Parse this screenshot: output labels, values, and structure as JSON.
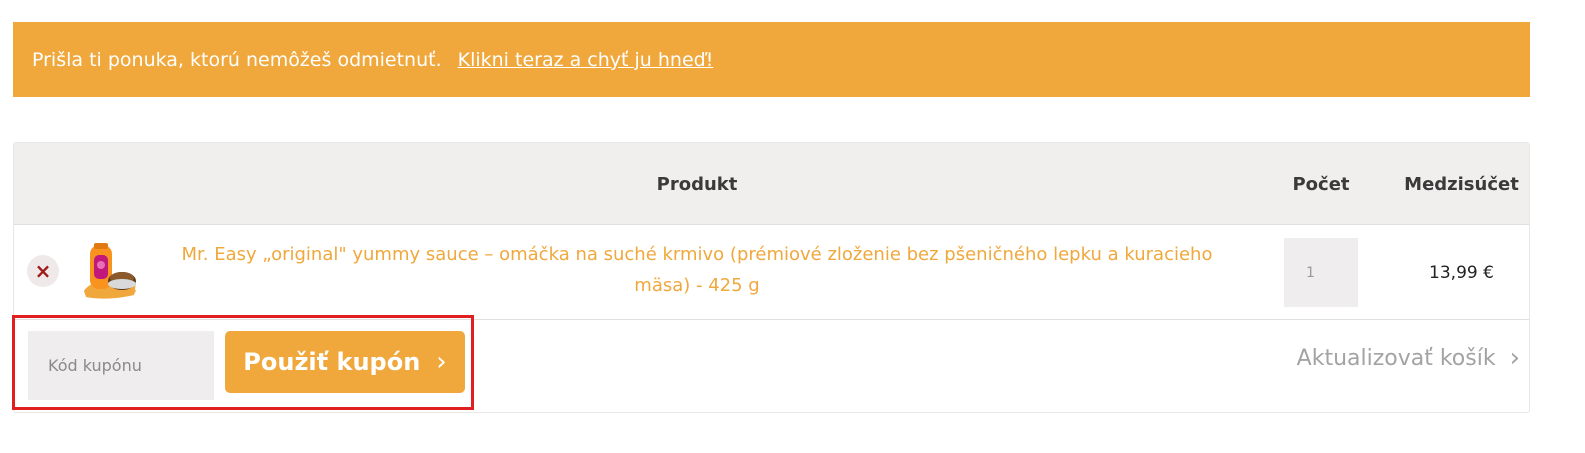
{
  "notice": {
    "message": "Prišla ti ponuka, ktorú nemôžeš odmietnuť.",
    "link": "Klikni teraz a chyť ju hneď!"
  },
  "cart": {
    "headers": {
      "product": "Produkt",
      "quantity": "Počet",
      "subtotal": "Medzisúčet"
    },
    "item": {
      "name": "Mr. Easy „original\" yummy sauce – omáčka na suché krmivo (prémiové zloženie bez pšeničného lepku a kuracieho mäsa) - 425 g",
      "quantity": "1",
      "price": "13,99 €",
      "remove_icon": "×"
    },
    "coupon": {
      "placeholder": "Kód kupónu",
      "apply_label": "Použiť kupón",
      "apply_icon": "›"
    },
    "update_label": "Aktualizovať košík",
    "update_icon": "›"
  },
  "colors": {
    "accent": "#f0a83c",
    "remove": "#9e1b1b",
    "highlight": "#e02020"
  }
}
